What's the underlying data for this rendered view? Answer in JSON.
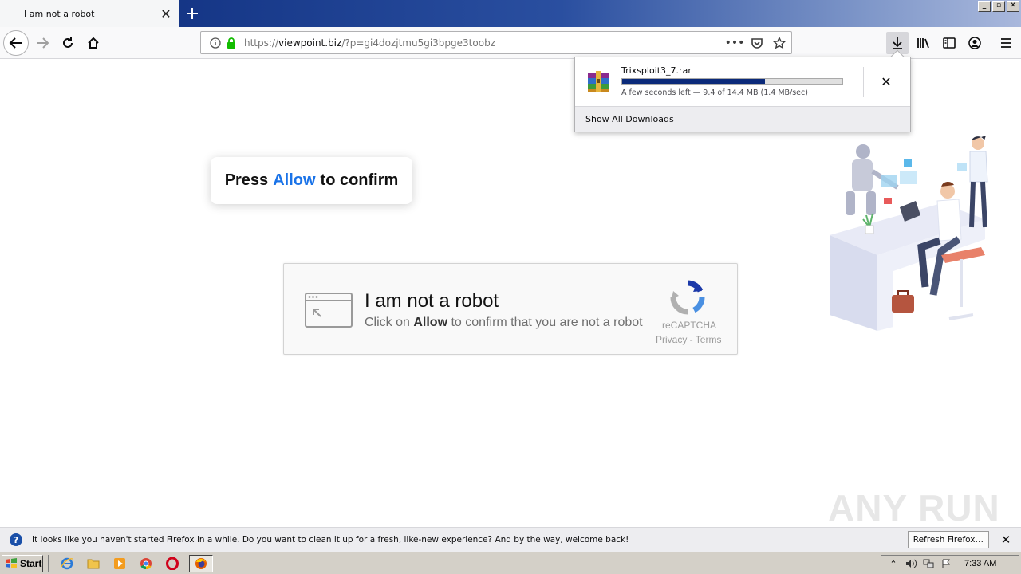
{
  "tab": {
    "title": "I am not a robot"
  },
  "urlbar": {
    "prefix": "https://",
    "domain": "viewpoint.biz",
    "path": "/?p=gi4dozjtmu5gi3bpge3toobz"
  },
  "download": {
    "filename": "Trixsploit3_7.rar",
    "progress_fraction": 0.65,
    "status": "A few seconds left — 9.4 of 14.4 MB (1.4 MB/sec)",
    "show_all": "Show All Downloads"
  },
  "page": {
    "press_prefix": "Press",
    "press_allow": "Allow",
    "press_suffix": "to confirm",
    "captcha_title": "I am not a robot",
    "captcha_sub_before": "Click on ",
    "captcha_sub_allow": "Allow",
    "captcha_sub_after": " to confirm that you are not a robot",
    "recaptcha_label": "reCAPTCHA",
    "recaptcha_links": "Privacy - Terms",
    "watermark": "ANY RUN"
  },
  "notification": {
    "text": "It looks like you haven't started Firefox in a while. Do you want to clean it up for a fresh, like-new experience? And by the way, welcome back!",
    "button": "Refresh Firefox…"
  },
  "taskbar": {
    "start": "Start",
    "clock": "7:33 AM"
  },
  "colors": {
    "accent": "#1a73e8",
    "lock": "#12bc00",
    "progress": "#0b2a7a"
  }
}
